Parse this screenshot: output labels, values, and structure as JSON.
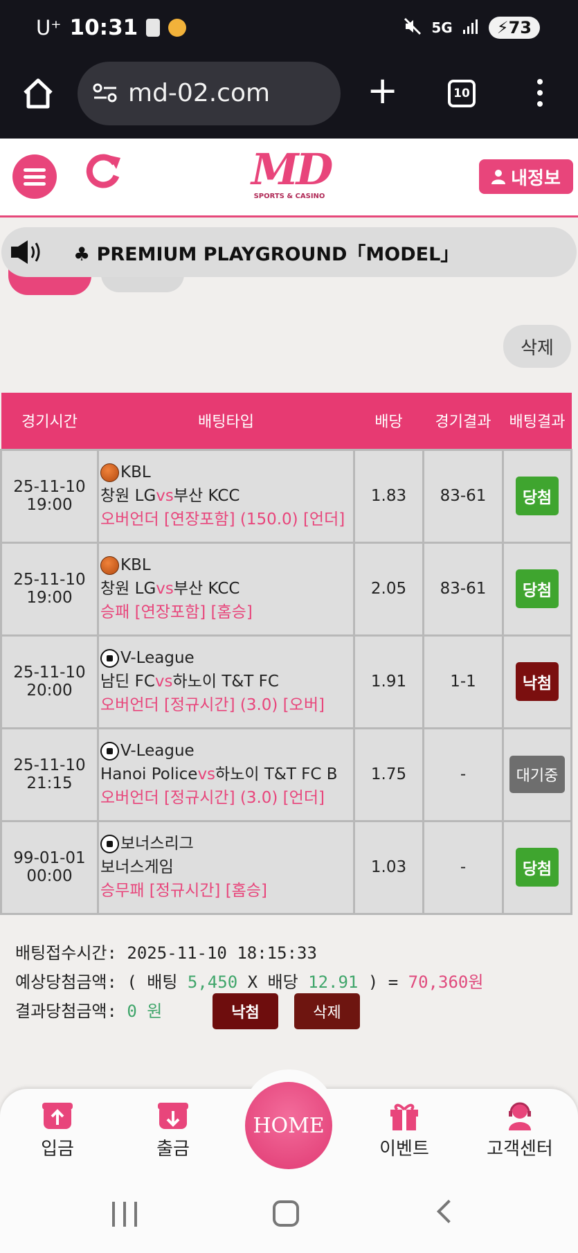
{
  "status_bar": {
    "carrier": "U⁺",
    "time": "10:31",
    "network": "5G",
    "battery": "73"
  },
  "browser": {
    "url": "md-02.com",
    "tab_count": "10"
  },
  "header": {
    "logo_text": "MD",
    "logo_sub": "SPORTS & CASINO",
    "my_info_label": "내정보"
  },
  "notice": {
    "text": "♣ PREMIUM PLAYGROUND「MODEL」"
  },
  "actions": {
    "delete_label": "삭제"
  },
  "table": {
    "headers": [
      "경기시간",
      "배팅타입",
      "배당",
      "경기결과",
      "배팅결과"
    ],
    "rows": [
      {
        "date": "25-11-10",
        "time": "19:00",
        "league": "KBL",
        "sport_icon": "basketball-icon",
        "home": "창원 LG",
        "vs": "vs",
        "away": "부산 KCC",
        "bet_type": "오버언더 [연장포함] (150.0) [언더]",
        "odds": "1.83",
        "score": "83-61",
        "result": "당첨",
        "result_status": "win"
      },
      {
        "date": "25-11-10",
        "time": "19:00",
        "league": "KBL",
        "sport_icon": "basketball-icon",
        "home": "창원 LG",
        "vs": "vs",
        "away": "부산 KCC",
        "bet_type": "승패 [연장포함] [홈승]",
        "odds": "2.05",
        "score": "83-61",
        "result": "당첨",
        "result_status": "win"
      },
      {
        "date": "25-11-10",
        "time": "20:00",
        "league": "V-League",
        "sport_icon": "soccer-icon",
        "home": "남딘 FC",
        "vs": "vs",
        "away": "하노이 T&T FC",
        "bet_type": "오버언더 [정규시간] (3.0) [오버]",
        "odds": "1.91",
        "score": "1-1",
        "result": "낙첨",
        "result_status": "lose"
      },
      {
        "date": "25-11-10",
        "time": "21:15",
        "league": "V-League",
        "sport_icon": "soccer-icon",
        "home": "Hanoi Police",
        "vs": "vs",
        "away": "하노이 T&T FC B",
        "bet_type": "오버언더 [정규시간] (3.0) [언더]",
        "odds": "1.75",
        "score": "-",
        "result": "대기중",
        "result_status": "wait"
      },
      {
        "date": "99-01-01",
        "time": "00:00",
        "league": "보너스리그",
        "sport_icon": "soccer-icon",
        "home": "보너스게임",
        "vs": "",
        "away": "",
        "bet_type": "승무패 [정규시간] [홈승]",
        "odds": "1.03",
        "score": "-",
        "result": "당첨",
        "result_status": "win"
      }
    ]
  },
  "summary": {
    "accept_time_label": "배팅접수시간:",
    "accept_time": "2025-11-10 18:15:33",
    "expected_label": "예상당첨금액:",
    "open_paren": "( 배팅",
    "bet_amount": "5,450",
    "times": "X 배당",
    "total_odds": "12.91",
    "close_eq": ") =",
    "expected_amount": "70,360원",
    "result_label": "결과당첨금액:",
    "result_amount": "0 원",
    "lose_button": "낙첨",
    "delete_button": "삭제"
  },
  "bottom_nav": {
    "deposit": "입금",
    "withdraw": "출금",
    "home": "HOME",
    "event": "이벤트",
    "support": "고객센터"
  },
  "colors": {
    "brand": "#e8457b",
    "table_header": "#e73a72",
    "win": "#3fa52f",
    "lose": "#7b0f0f",
    "wait": "#6e6e6e"
  }
}
